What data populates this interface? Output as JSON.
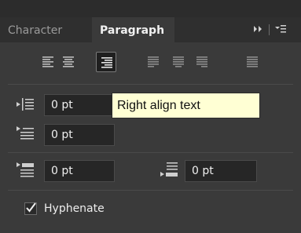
{
  "tabs": {
    "character": "Character",
    "paragraph": "Paragraph"
  },
  "panel_menu": {
    "collapse_icon": "double-chevron-right-icon",
    "menu_icon": "panel-menu-icon"
  },
  "alignment_buttons": [
    {
      "name": "align-left-button",
      "icon": "align-left-icon",
      "active": false
    },
    {
      "name": "align-center-button",
      "icon": "align-center-icon",
      "active": false
    },
    {
      "name": "align-right-button",
      "icon": "align-right-icon",
      "active": true
    },
    {
      "name": "justify-last-left-button",
      "icon": "justify-last-left-icon",
      "active": false
    },
    {
      "name": "justify-last-center-button",
      "icon": "justify-last-center-icon",
      "active": false
    },
    {
      "name": "justify-last-right-button",
      "icon": "justify-last-right-icon",
      "active": false
    },
    {
      "name": "justify-all-button",
      "icon": "justify-all-icon",
      "active": false
    }
  ],
  "fields": {
    "indent_left": "0 pt",
    "first_line_indent": "0 pt",
    "space_before": "0 pt",
    "space_after": "0 pt"
  },
  "tooltip": {
    "text": "Right align text"
  },
  "hyphenate": {
    "label": "Hyphenate",
    "checked": true,
    "check_glyph": "✓"
  },
  "colors": {
    "panel_bg": "#3a3a3a",
    "tab_bar_bg": "#2f2f2f",
    "tooltip_bg": "#ffffd4",
    "field_bg": "#262626"
  }
}
